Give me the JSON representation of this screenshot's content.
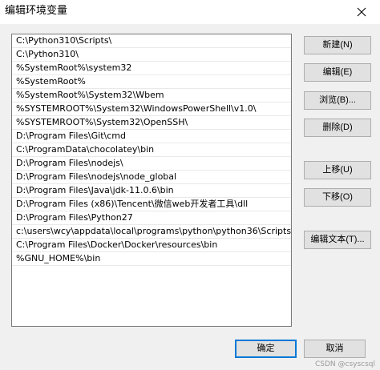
{
  "window": {
    "title": "编辑环境变量"
  },
  "paths": [
    "C:\\Python310\\Scripts\\",
    "C:\\Python310\\",
    "%SystemRoot%\\system32",
    "%SystemRoot%",
    "%SystemRoot%\\System32\\Wbem",
    "%SYSTEMROOT%\\System32\\WindowsPowerShell\\v1.0\\",
    "%SYSTEMROOT%\\System32\\OpenSSH\\",
    "D:\\Program Files\\Git\\cmd",
    "C:\\ProgramData\\chocolatey\\bin",
    "D:\\Program Files\\nodejs\\",
    "D:\\Program Files\\nodejs\\node_global",
    "D:\\Program Files\\Java\\jdk-11.0.6\\bin",
    "D:\\Program Files (x86)\\Tencent\\微信web开发者工具\\dll",
    "D:\\Program Files\\Python27",
    "c:\\users\\wcy\\appdata\\local\\programs\\python\\python36\\Scripts",
    "C:\\Program Files\\Docker\\Docker\\resources\\bin",
    "%GNU_HOME%\\bin"
  ],
  "buttons": {
    "new": "新建(N)",
    "edit": "编辑(E)",
    "browse": "浏览(B)...",
    "delete": "删除(D)",
    "move_up": "上移(U)",
    "move_down": "下移(O)",
    "edit_text": "编辑文本(T)...",
    "ok": "确定",
    "cancel": "取消"
  },
  "watermark": "CSDN @csyscsql",
  "icons": {
    "close": "close-icon"
  },
  "colors": {
    "accent": "#0078d7",
    "button_bg": "#e1e1e1",
    "dialog_bg": "#f0f0f0"
  }
}
